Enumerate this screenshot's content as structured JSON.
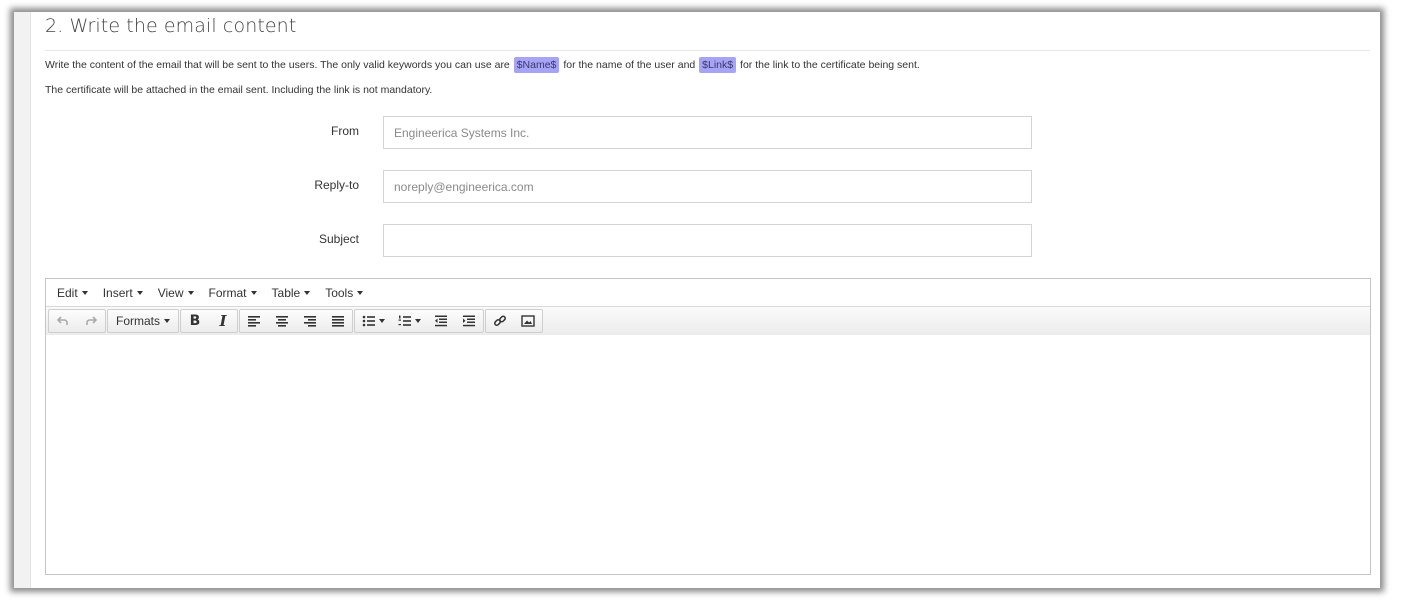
{
  "section": {
    "title": "2. Write the email content",
    "desc_line1_prefix": "Write the content of the email that will be sent to the users. The only valid keywords you can use are",
    "keyword_name": "$Name$",
    "desc_line1_mid": "for the name of the user and",
    "keyword_link": "$Link$",
    "desc_line1_suffix": "for the link to the certificate being sent.",
    "desc_line2": "The certificate will be attached in the email sent. Including the link is not mandatory."
  },
  "form": {
    "from_label": "From",
    "from_placeholder": "Engineerica Systems Inc.",
    "reply_label": "Reply-to",
    "reply_placeholder": "noreply@engineerica.com",
    "subject_label": "Subject",
    "subject_value": ""
  },
  "editor": {
    "menu": [
      "Edit",
      "Insert",
      "View",
      "Format",
      "Table",
      "Tools"
    ],
    "formats_label": "Formats",
    "bold_glyph": "B",
    "italic_glyph": "I"
  },
  "colors": {
    "keyword_bg": "#a7a4f6",
    "border": "#d4d4d4"
  }
}
